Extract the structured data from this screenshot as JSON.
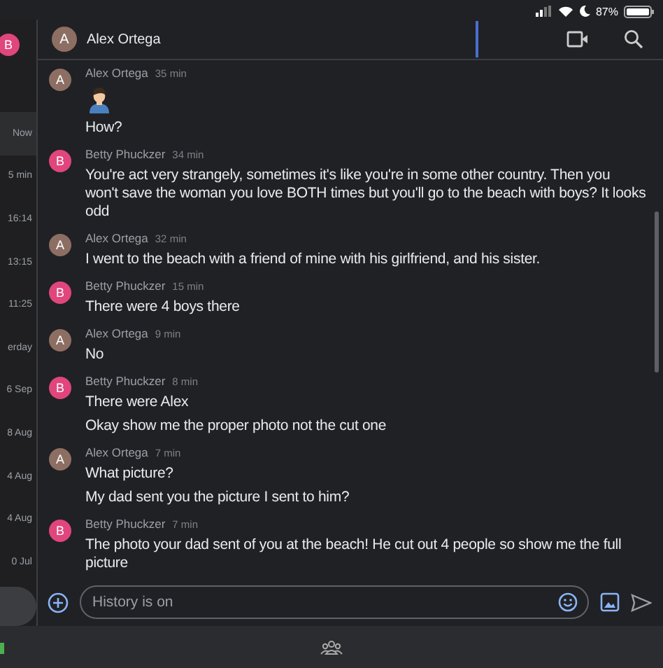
{
  "status_bar": {
    "battery": "87%"
  },
  "sidebar": {
    "avatar": {
      "letter": "B",
      "color": "#e0457b"
    },
    "items": [
      {
        "time": "Now",
        "selected": true
      },
      {
        "time": "5 min",
        "selected": false
      },
      {
        "time": "16:14",
        "selected": false
      },
      {
        "time": "13:15",
        "selected": false
      },
      {
        "time": "11:25",
        "selected": false
      },
      {
        "time": "erday",
        "selected": false
      },
      {
        "time": "6 Sep",
        "selected": false
      },
      {
        "time": "8 Aug",
        "selected": false
      },
      {
        "time": "4 Aug",
        "selected": false
      },
      {
        "time": "4 Aug",
        "selected": false
      },
      {
        "time": "0 Jul",
        "selected": false
      }
    ]
  },
  "header": {
    "title": "Alex Ortega",
    "avatar": {
      "letter": "A",
      "color": "#8d6e63"
    }
  },
  "messages": [
    {
      "sender": "Alex Ortega",
      "avatar": "A",
      "color": "#8d6e63",
      "time": "35 min",
      "parts": [
        {
          "kind": "emoji"
        },
        {
          "kind": "text",
          "text": "How?"
        }
      ]
    },
    {
      "sender": "Betty Phuckzer",
      "avatar": "B",
      "color": "#e0457b",
      "time": "34 min",
      "parts": [
        {
          "kind": "text",
          "text": "You're act very strangely, sometimes it's like you're in some other country. Then you won't save the woman you love BOTH times but you'll go to the beach with boys? It looks odd"
        }
      ]
    },
    {
      "sender": "Alex Ortega",
      "avatar": "A",
      "color": "#8d6e63",
      "time": "32 min",
      "parts": [
        {
          "kind": "text",
          "text": "I  went to the beach with a friend of mine  with his girlfriend,  and his sister."
        }
      ]
    },
    {
      "sender": "Betty Phuckzer",
      "avatar": "B",
      "color": "#e0457b",
      "time": "15 min",
      "parts": [
        {
          "kind": "text",
          "text": "There were 4 boys there"
        }
      ]
    },
    {
      "sender": "Alex Ortega",
      "avatar": "A",
      "color": "#8d6e63",
      "time": "9 min",
      "parts": [
        {
          "kind": "text",
          "text": "No"
        }
      ]
    },
    {
      "sender": "Betty Phuckzer",
      "avatar": "B",
      "color": "#e0457b",
      "time": "8 min",
      "parts": [
        {
          "kind": "text",
          "text": "There were Alex"
        },
        {
          "kind": "text",
          "text": "Okay show me the proper photo not the cut one"
        }
      ]
    },
    {
      "sender": "Alex Ortega",
      "avatar": "A",
      "color": "#8d6e63",
      "time": "7 min",
      "parts": [
        {
          "kind": "text",
          "text": "What picture?"
        },
        {
          "kind": "text",
          "text": "My dad sent you the picture I sent to him?"
        }
      ]
    },
    {
      "sender": "Betty Phuckzer",
      "avatar": "B",
      "color": "#e0457b",
      "time": "7 min",
      "parts": [
        {
          "kind": "text",
          "text": "The photo your dad sent of you at the beach! He cut out 4 people so show  me the full picture"
        }
      ]
    }
  ],
  "composer": {
    "placeholder": "History is on"
  }
}
